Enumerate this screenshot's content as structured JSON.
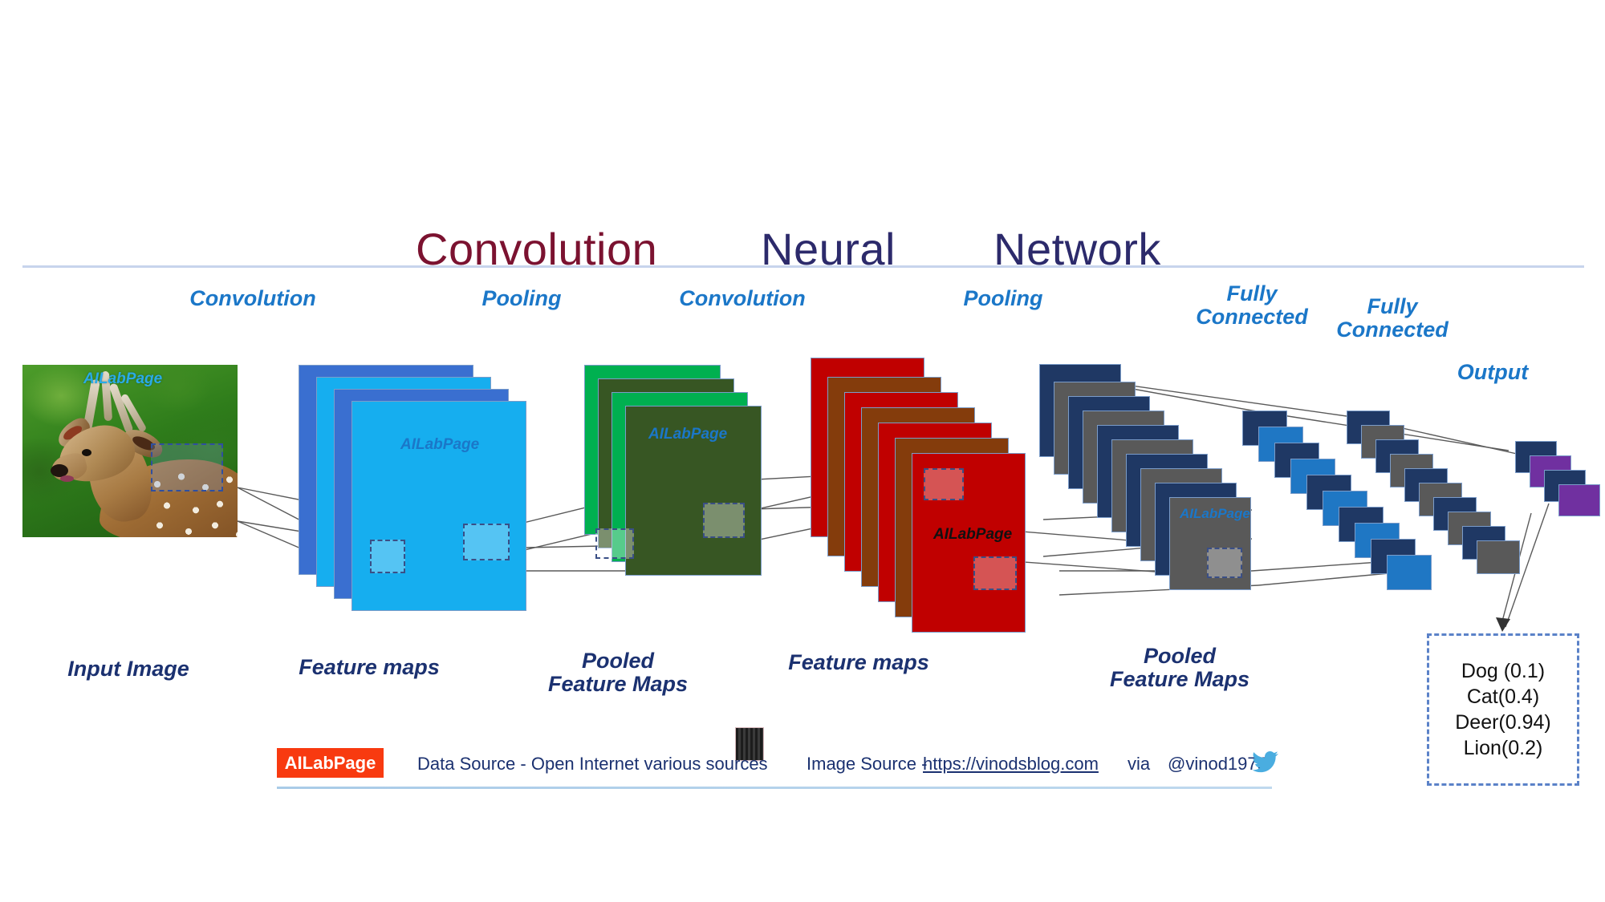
{
  "title": {
    "words": [
      "Convolution",
      "Neural",
      "Network"
    ]
  },
  "stage_labels": [
    {
      "text": "Convolution"
    },
    {
      "text": "Pooling"
    },
    {
      "text": "Convolution"
    },
    {
      "text": "Pooling"
    },
    {
      "line1": "Fully",
      "line2": "Connected"
    },
    {
      "line1": "Fully",
      "line2": "Connected"
    },
    {
      "text": "Output"
    }
  ],
  "bottom_labels": [
    {
      "line1": "Input Image",
      "line2": ""
    },
    {
      "line1": "Feature maps",
      "line2": ""
    },
    {
      "line1": "Pooled",
      "line2": "Feature Maps"
    },
    {
      "line1": "Feature maps",
      "line2": ""
    },
    {
      "line1": "Pooled",
      "line2": "Feature Maps"
    }
  ],
  "watermark": "AILabPage",
  "output_box": {
    "rows": [
      "Dog (0.1)",
      "Cat(0.4)",
      "Deer(0.94)",
      "Lion(0.2)"
    ]
  },
  "footer": {
    "badge": "AILabPage",
    "data_source": "Data Source -  Open Internet  various sources",
    "image_source_label": "Image Source -",
    "image_source_url": "https://vinodsblog.com",
    "via_label": "via",
    "handle": "@vinod1975"
  },
  "colors": {
    "title_maroon": "#7B1230",
    "title_navy": "#2C2A6B",
    "stage_label_blue": "#1B77C8",
    "bottom_label_navy": "#1B3170",
    "conv1_a": "#3A6FD0",
    "conv1_b": "#16AEEF",
    "pool1_a": "#00B050",
    "pool1_b": "#375623",
    "conv2_a": "#C00000",
    "conv2_b": "#843C0C",
    "pool2_a": "#1F3864",
    "pool2_b": "#595959",
    "fc1_a": "#1F3864",
    "fc1_b": "#1F77C4",
    "fc2_a": "#1F3864",
    "fc2_b": "#595959",
    "out_a": "#1F3864",
    "out_b": "#7030A0",
    "badge_red": "#F83A10",
    "wire_gray": "#5A5A5A",
    "rule_blue": "#C7D4EC"
  },
  "chart_data": {
    "type": "diagram",
    "title": "Convolution Neural Network",
    "stages": [
      {
        "name": "Input Image",
        "kind": "image",
        "layers": 1
      },
      {
        "name": "Convolution",
        "kind": "stack",
        "layers": 4,
        "output": "Feature maps"
      },
      {
        "name": "Pooling",
        "kind": "stack",
        "layers": 4,
        "output": "Pooled Feature Maps"
      },
      {
        "name": "Convolution",
        "kind": "stack",
        "layers": 7,
        "output": "Feature maps"
      },
      {
        "name": "Pooling",
        "kind": "stack",
        "layers": 10,
        "output": "Pooled Feature Maps"
      },
      {
        "name": "Fully Connected",
        "kind": "chain",
        "layers": 10
      },
      {
        "name": "Fully Connected",
        "kind": "chain",
        "layers": 10
      },
      {
        "name": "Output",
        "kind": "chain",
        "layers": 4
      }
    ],
    "predictions": [
      {
        "label": "Dog",
        "score": 0.1
      },
      {
        "label": "Cat",
        "score": 0.4
      },
      {
        "label": "Deer",
        "score": 0.94
      },
      {
        "label": "Lion",
        "score": 0.2
      }
    ]
  }
}
